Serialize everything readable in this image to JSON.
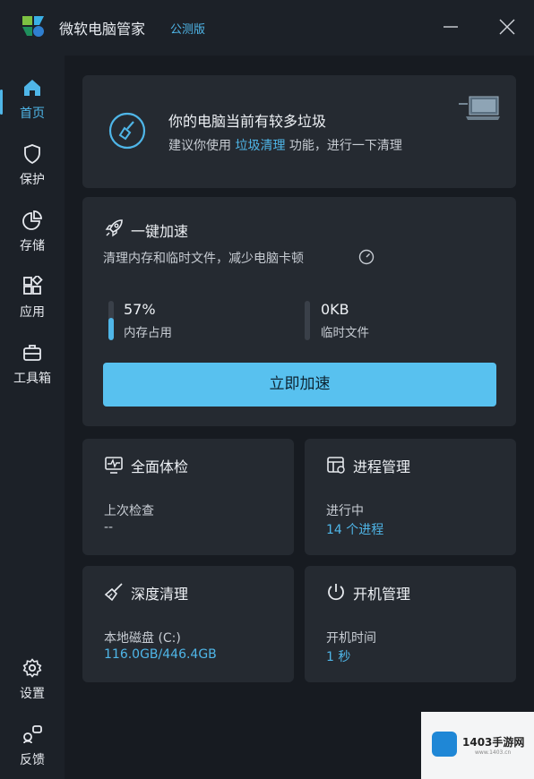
{
  "window": {
    "app_title": "微软电脑管家",
    "badge": "公测版",
    "controls": {
      "minimize_icon": "minimize-icon",
      "close_icon": "close-icon"
    }
  },
  "sidebar": {
    "items": [
      {
        "label": "首页",
        "icon": "home-icon",
        "active": true
      },
      {
        "label": "保护",
        "icon": "shield-icon"
      },
      {
        "label": "存储",
        "icon": "pie-chart-icon"
      },
      {
        "label": "应用",
        "icon": "apps-icon"
      },
      {
        "label": "工具箱",
        "icon": "toolbox-icon"
      }
    ],
    "bottom": [
      {
        "label": "设置",
        "icon": "gear-icon"
      },
      {
        "label": "反馈",
        "icon": "feedback-icon"
      }
    ]
  },
  "banner": {
    "title": "你的电脑当前有较多垃圾",
    "sub_prefix": "建议你使用 ",
    "sub_link": "垃圾清理",
    "sub_suffix": " 功能，进行一下清理"
  },
  "boost": {
    "title": "一键加速",
    "description": "清理内存和临时文件，减少电脑卡顿",
    "memory": {
      "value": "57%",
      "label": "内存占用",
      "level": 0.57
    },
    "temp": {
      "value": "0KB",
      "label": "临时文件",
      "level": 0
    },
    "button_label": "立即加速"
  },
  "tiles": {
    "health": {
      "title": "全面体检",
      "label": "上次检查",
      "value": "--"
    },
    "process": {
      "title": "进程管理",
      "label": "进行中",
      "value": "14 个进程"
    },
    "deep_clean": {
      "title": "深度清理",
      "label": "本地磁盘 (C:)",
      "value": "116.0GB/446.4GB"
    },
    "startup": {
      "title": "开机管理",
      "label": "开机时间",
      "value": "1 秒"
    }
  },
  "watermark": {
    "text": "1403手游网",
    "sub": "www.1403.cn"
  },
  "colors": {
    "accent": "#4fb6e8",
    "button": "#58c1ef",
    "card": "#252a31",
    "background": "#171b21"
  }
}
